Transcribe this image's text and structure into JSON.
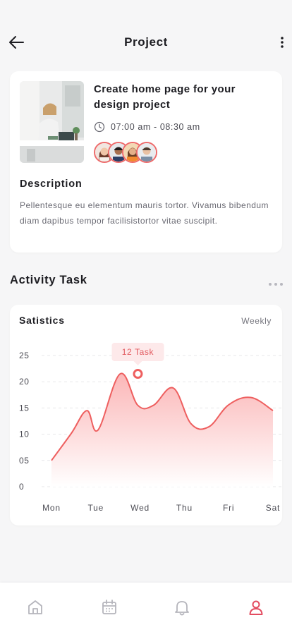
{
  "header": {
    "title": "Project",
    "back_icon": "arrow-left-icon",
    "more_icon": "more-vertical-icon"
  },
  "project": {
    "title": "Create home page for your design project",
    "time": "07:00 am - 08:30 am",
    "time_icon": "clock-icon",
    "photo": "office-desk-photo",
    "members": [
      "avatar-1",
      "avatar-2",
      "avatar-3",
      "avatar-4"
    ],
    "description_title": "Description",
    "description": "Pellentesque eu elementum mauris tortor. Vivamus bibendum diam dapibus tempor facilisistortor vitae suscipit."
  },
  "activity": {
    "title": "Activity Task",
    "more_icon": "more-horizontal-icon",
    "card_title": "Satistics",
    "range": "Weekly"
  },
  "chart_data": {
    "type": "area",
    "categories": [
      "Mon",
      "Tue",
      "Wed",
      "Thu",
      "Fri",
      "Sat"
    ],
    "y_tick_labels": [
      "0",
      "05",
      "10",
      "15",
      "20",
      "25"
    ],
    "ylim": [
      0,
      25
    ],
    "x": [
      0,
      0.45,
      0.8,
      1.05,
      1.55,
      1.95,
      2.3,
      2.75,
      3.15,
      3.55,
      4.0,
      4.5,
      5.0
    ],
    "values": [
      5,
      10.2,
      14.5,
      10.8,
      21.5,
      15.5,
      15.5,
      18.8,
      12.0,
      11.4,
      15.6,
      17,
      14.5
    ],
    "tooltip": {
      "text": "12 Task",
      "x": 1.95,
      "y": 21.5
    },
    "grid": "dashed horizontal",
    "colors": {
      "line": "#ee5f5f",
      "fill_top": "#fbb3b4",
      "fill_bottom": "#ffffff",
      "tooltip_bg": "#fde9ea",
      "tooltip_text": "#e25a5f"
    }
  },
  "nav": {
    "items": [
      {
        "icon": "home-icon",
        "active": false
      },
      {
        "icon": "calendar-icon",
        "active": false
      },
      {
        "icon": "bell-icon",
        "active": false
      },
      {
        "icon": "profile-icon",
        "active": true
      }
    ],
    "colors": {
      "inactive": "#b5b5bc",
      "active": "#e34c60"
    }
  }
}
